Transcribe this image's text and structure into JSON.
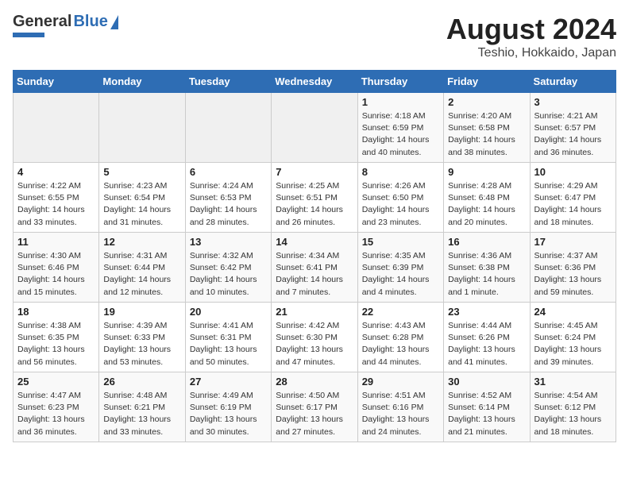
{
  "header": {
    "logo_general": "General",
    "logo_blue": "Blue",
    "title": "August 2024",
    "subtitle": "Teshio, Hokkaido, Japan"
  },
  "weekdays": [
    "Sunday",
    "Monday",
    "Tuesday",
    "Wednesday",
    "Thursday",
    "Friday",
    "Saturday"
  ],
  "weeks": [
    [
      {
        "day": "",
        "info": ""
      },
      {
        "day": "",
        "info": ""
      },
      {
        "day": "",
        "info": ""
      },
      {
        "day": "",
        "info": ""
      },
      {
        "day": "1",
        "info": "Sunrise: 4:18 AM\nSunset: 6:59 PM\nDaylight: 14 hours\nand 40 minutes."
      },
      {
        "day": "2",
        "info": "Sunrise: 4:20 AM\nSunset: 6:58 PM\nDaylight: 14 hours\nand 38 minutes."
      },
      {
        "day": "3",
        "info": "Sunrise: 4:21 AM\nSunset: 6:57 PM\nDaylight: 14 hours\nand 36 minutes."
      }
    ],
    [
      {
        "day": "4",
        "info": "Sunrise: 4:22 AM\nSunset: 6:55 PM\nDaylight: 14 hours\nand 33 minutes."
      },
      {
        "day": "5",
        "info": "Sunrise: 4:23 AM\nSunset: 6:54 PM\nDaylight: 14 hours\nand 31 minutes."
      },
      {
        "day": "6",
        "info": "Sunrise: 4:24 AM\nSunset: 6:53 PM\nDaylight: 14 hours\nand 28 minutes."
      },
      {
        "day": "7",
        "info": "Sunrise: 4:25 AM\nSunset: 6:51 PM\nDaylight: 14 hours\nand 26 minutes."
      },
      {
        "day": "8",
        "info": "Sunrise: 4:26 AM\nSunset: 6:50 PM\nDaylight: 14 hours\nand 23 minutes."
      },
      {
        "day": "9",
        "info": "Sunrise: 4:28 AM\nSunset: 6:48 PM\nDaylight: 14 hours\nand 20 minutes."
      },
      {
        "day": "10",
        "info": "Sunrise: 4:29 AM\nSunset: 6:47 PM\nDaylight: 14 hours\nand 18 minutes."
      }
    ],
    [
      {
        "day": "11",
        "info": "Sunrise: 4:30 AM\nSunset: 6:46 PM\nDaylight: 14 hours\nand 15 minutes."
      },
      {
        "day": "12",
        "info": "Sunrise: 4:31 AM\nSunset: 6:44 PM\nDaylight: 14 hours\nand 12 minutes."
      },
      {
        "day": "13",
        "info": "Sunrise: 4:32 AM\nSunset: 6:42 PM\nDaylight: 14 hours\nand 10 minutes."
      },
      {
        "day": "14",
        "info": "Sunrise: 4:34 AM\nSunset: 6:41 PM\nDaylight: 14 hours\nand 7 minutes."
      },
      {
        "day": "15",
        "info": "Sunrise: 4:35 AM\nSunset: 6:39 PM\nDaylight: 14 hours\nand 4 minutes."
      },
      {
        "day": "16",
        "info": "Sunrise: 4:36 AM\nSunset: 6:38 PM\nDaylight: 14 hours\nand 1 minute."
      },
      {
        "day": "17",
        "info": "Sunrise: 4:37 AM\nSunset: 6:36 PM\nDaylight: 13 hours\nand 59 minutes."
      }
    ],
    [
      {
        "day": "18",
        "info": "Sunrise: 4:38 AM\nSunset: 6:35 PM\nDaylight: 13 hours\nand 56 minutes."
      },
      {
        "day": "19",
        "info": "Sunrise: 4:39 AM\nSunset: 6:33 PM\nDaylight: 13 hours\nand 53 minutes."
      },
      {
        "day": "20",
        "info": "Sunrise: 4:41 AM\nSunset: 6:31 PM\nDaylight: 13 hours\nand 50 minutes."
      },
      {
        "day": "21",
        "info": "Sunrise: 4:42 AM\nSunset: 6:30 PM\nDaylight: 13 hours\nand 47 minutes."
      },
      {
        "day": "22",
        "info": "Sunrise: 4:43 AM\nSunset: 6:28 PM\nDaylight: 13 hours\nand 44 minutes."
      },
      {
        "day": "23",
        "info": "Sunrise: 4:44 AM\nSunset: 6:26 PM\nDaylight: 13 hours\nand 41 minutes."
      },
      {
        "day": "24",
        "info": "Sunrise: 4:45 AM\nSunset: 6:24 PM\nDaylight: 13 hours\nand 39 minutes."
      }
    ],
    [
      {
        "day": "25",
        "info": "Sunrise: 4:47 AM\nSunset: 6:23 PM\nDaylight: 13 hours\nand 36 minutes."
      },
      {
        "day": "26",
        "info": "Sunrise: 4:48 AM\nSunset: 6:21 PM\nDaylight: 13 hours\nand 33 minutes."
      },
      {
        "day": "27",
        "info": "Sunrise: 4:49 AM\nSunset: 6:19 PM\nDaylight: 13 hours\nand 30 minutes."
      },
      {
        "day": "28",
        "info": "Sunrise: 4:50 AM\nSunset: 6:17 PM\nDaylight: 13 hours\nand 27 minutes."
      },
      {
        "day": "29",
        "info": "Sunrise: 4:51 AM\nSunset: 6:16 PM\nDaylight: 13 hours\nand 24 minutes."
      },
      {
        "day": "30",
        "info": "Sunrise: 4:52 AM\nSunset: 6:14 PM\nDaylight: 13 hours\nand 21 minutes."
      },
      {
        "day": "31",
        "info": "Sunrise: 4:54 AM\nSunset: 6:12 PM\nDaylight: 13 hours\nand 18 minutes."
      }
    ]
  ]
}
